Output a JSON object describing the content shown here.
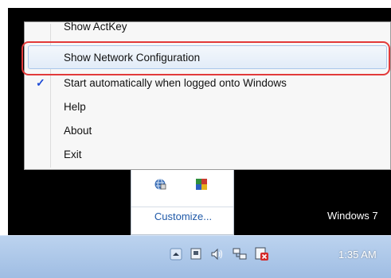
{
  "menu": {
    "items": [
      {
        "label": "Show ActKey",
        "checked": false,
        "highlighted": false
      },
      {
        "label": "Show Network Configuration",
        "checked": false,
        "highlighted": true
      },
      {
        "label": "Start automatically when logged onto Windows",
        "checked": true,
        "highlighted": false
      },
      {
        "label": "Help",
        "checked": false,
        "highlighted": false
      },
      {
        "label": "About",
        "checked": false,
        "highlighted": false
      },
      {
        "label": "Exit",
        "checked": false,
        "highlighted": false
      }
    ],
    "check_glyph": "✓"
  },
  "tray_panel": {
    "customize_label": "Customize..."
  },
  "watermark": "Windows 7",
  "taskbar": {
    "clock": "1:35 AM",
    "icons": [
      "show-hidden-icons-arrow-icon",
      "action-center-flag-icon",
      "volume-speaker-icon",
      "network-icon",
      "error-notification-icon"
    ]
  },
  "colors": {
    "highlight_border": "#e23a3a",
    "check": "#1d4bd6",
    "link": "#1f59a8",
    "taskbar": "#a8c4e8"
  }
}
